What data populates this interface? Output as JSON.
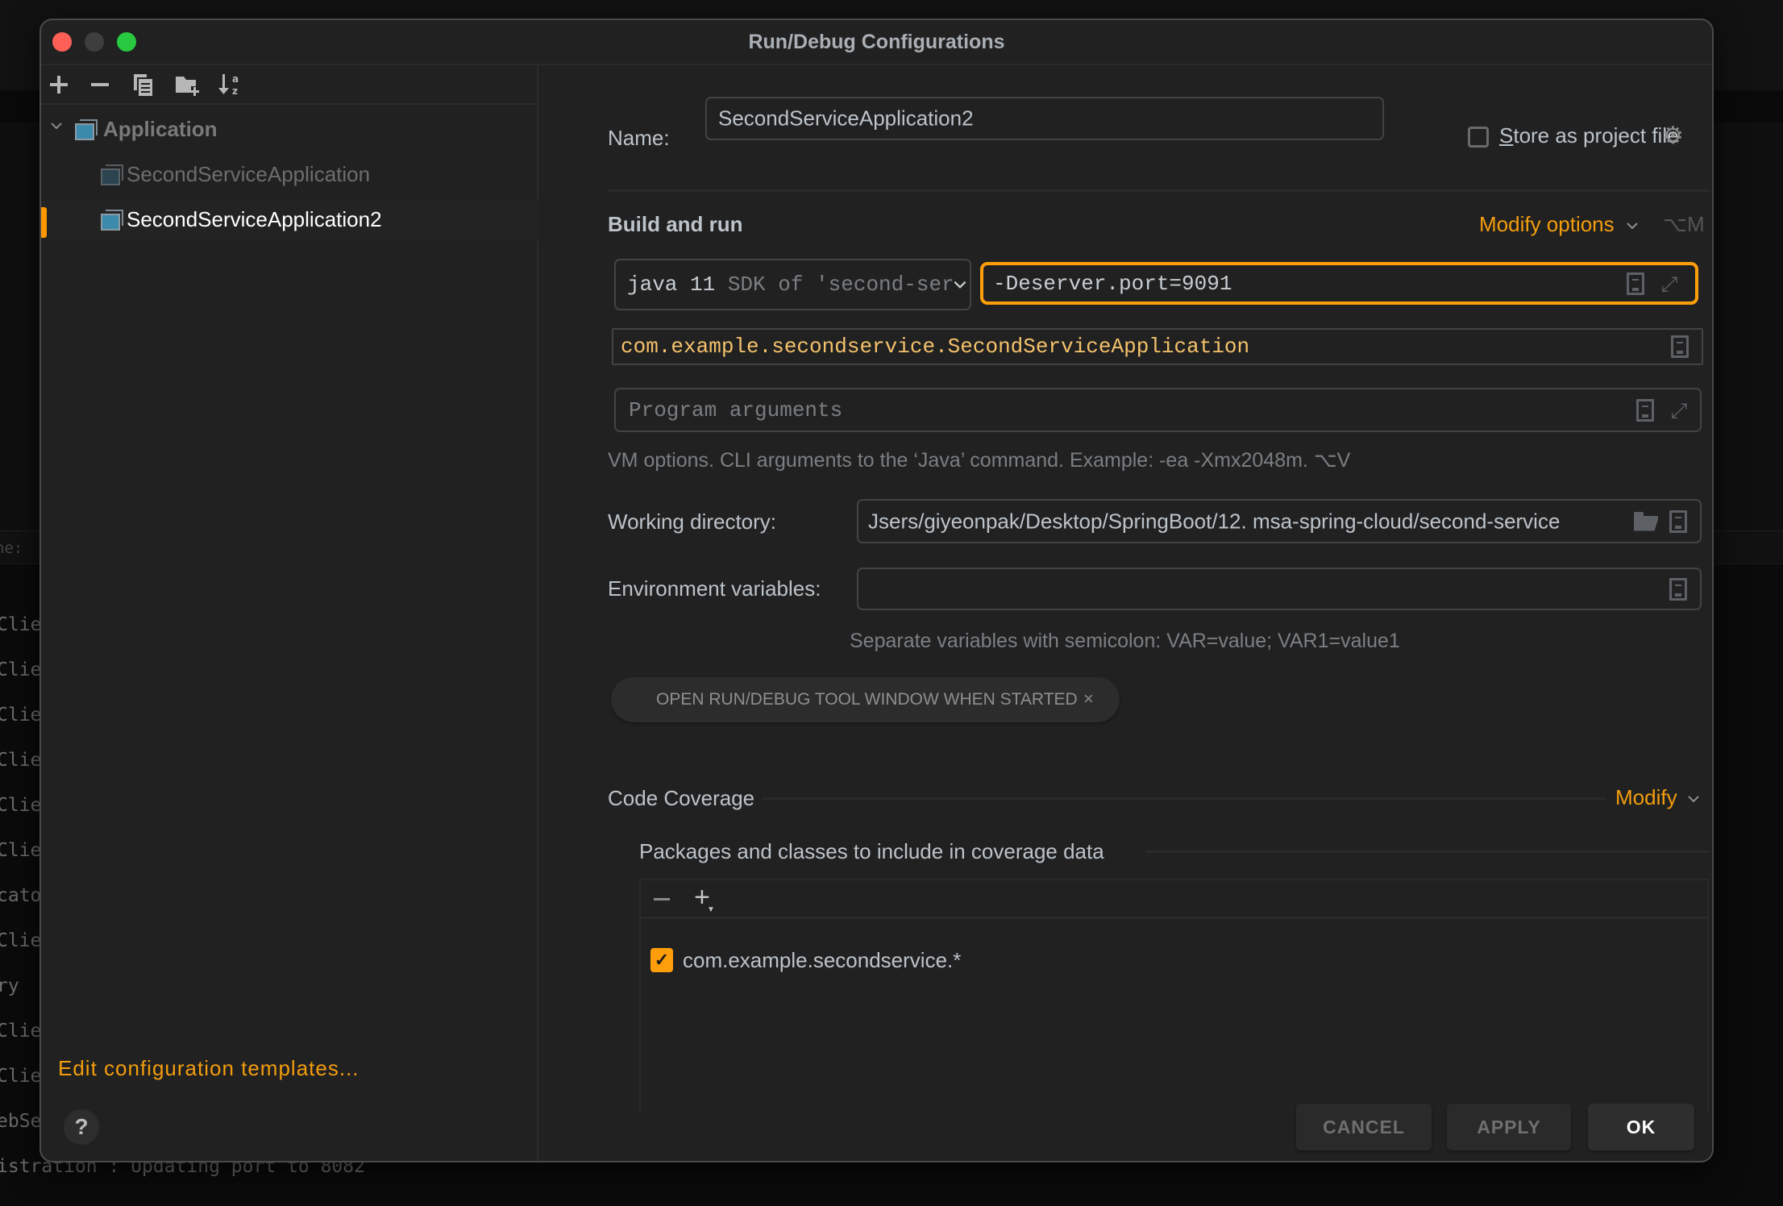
{
  "background": {
    "search_fragment": "ne:",
    "console_lines": [
      "Clie",
      "Clie",
      "Clie",
      "Clie",
      "Clie",
      "Clie",
      "cato",
      "Clie",
      "ry",
      "Clie",
      "Clie",
      "ebSe"
    ],
    "console_bottom": "istration : Updating port to 8082"
  },
  "dialog": {
    "title": "Run/Debug Configurations"
  },
  "sidebar": {
    "toolbar": {
      "add": "+",
      "remove": "−",
      "copy": "copy-icon",
      "new_folder": "new-folder-icon",
      "sort": "sort-alpha-icon"
    },
    "tree": {
      "group_label": "Application",
      "items": [
        {
          "label": "SecondServiceApplication",
          "selected": false
        },
        {
          "label": "SecondServiceApplication2",
          "selected": true
        }
      ]
    },
    "edit_templates": "Edit configuration templates...",
    "help": "?"
  },
  "form": {
    "name_label": "Name:",
    "name_value": "SecondServiceApplication2",
    "store_label_first": "S",
    "store_label_rest": "tore as project file",
    "store_checked": false,
    "build_run_title": "Build and run",
    "modify_options": "Modify options",
    "modify_options_shortcut": "⌥M",
    "jre_version": "java 11",
    "jre_desc": "SDK of 'second-ser",
    "vm_options": "-Deserver.port=9091",
    "main_class": "com.example.secondservice.SecondServiceApplication",
    "program_args_placeholder": "Program arguments",
    "vm_hint": "VM options. CLI arguments to the ‘Java’ command. Example: -ea -Xmx2048m. ⌥V",
    "working_dir_label": "Working directory:",
    "working_dir_value": "Jsers/giyeonpak/Desktop/SpringBoot/12. msa-spring-cloud/second-service",
    "env_label": "Environment variables:",
    "env_value": "",
    "env_hint": "Separate variables with semicolon: VAR=value; VAR1=value1",
    "chip_label": "OPEN RUN/DEBUG TOOL WINDOW WHEN STARTED",
    "chip_close": "×"
  },
  "coverage": {
    "title": "Code Coverage",
    "modify": "Modify",
    "packages_title": "Packages and classes to include in coverage data",
    "items": [
      {
        "label": "com.example.secondservice.*",
        "checked": true
      }
    ]
  },
  "buttons": {
    "cancel": "CANCEL",
    "apply": "APPLY",
    "ok": "OK"
  },
  "colors": {
    "accent": "#ff9e0b",
    "link": "#f39d0c",
    "main_class": "#f5c26b",
    "scrollbar": "#4a3519"
  }
}
